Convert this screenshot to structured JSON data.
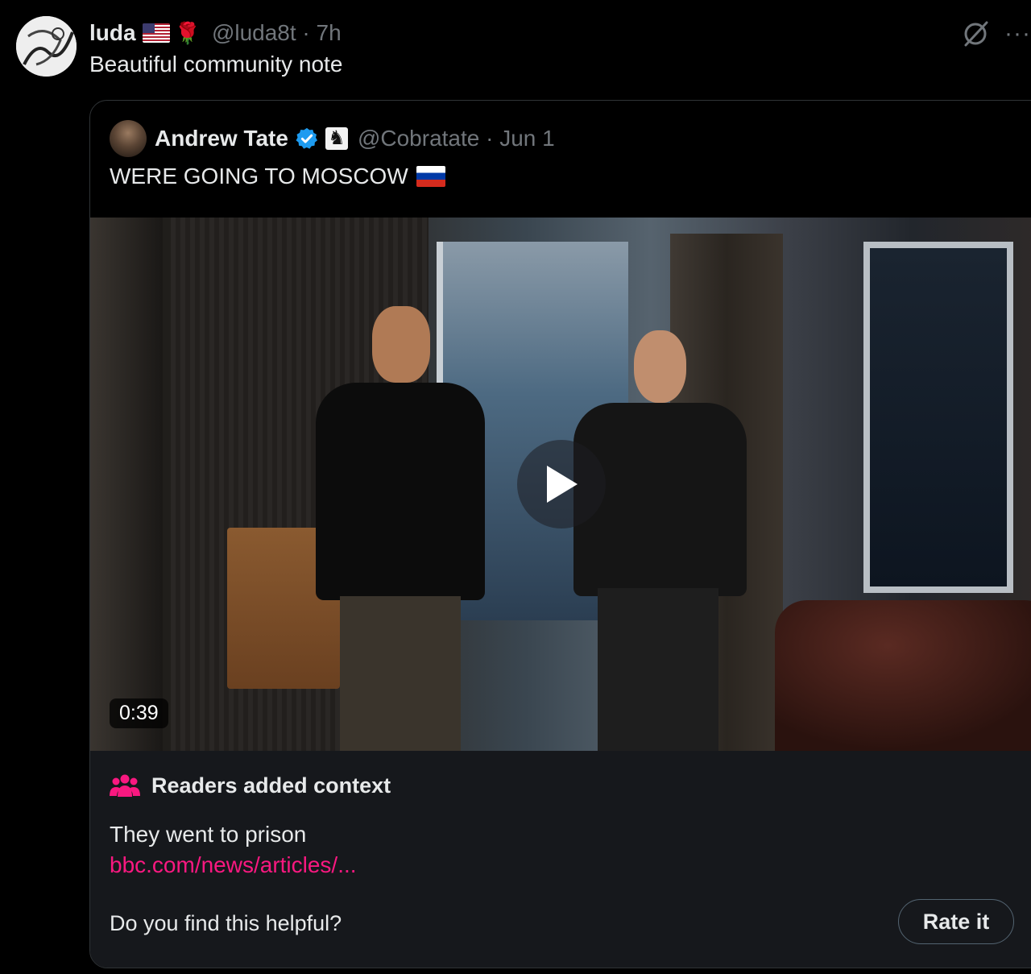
{
  "post": {
    "display_name": "luda",
    "flag_icon": "us-flag-icon",
    "rose_icon": "rose-icon",
    "handle_time": "@luda8t · 7h",
    "text": "Beautiful community note",
    "more_label": "···"
  },
  "quote": {
    "display_name": "Andrew Tate",
    "verified_icon": "verified-badge-icon",
    "affiliate_icon": "chess-knight-icon",
    "handle_time": "@Cobratate · Jun 1",
    "text": "WERE GOING TO MOSCOW",
    "flag_icon": "russia-flag-icon",
    "video": {
      "duration": "0:39",
      "play_icon": "play-icon"
    }
  },
  "note": {
    "title": "Readers added context",
    "body": "They went to prison",
    "link": "bbc.com/news/articles/...",
    "question": "Do you find this helpful?",
    "rate_label": "Rate it"
  },
  "colors": {
    "background": "#000000",
    "text_primary": "#e7e9ea",
    "text_secondary": "#71767b",
    "verified_blue": "#1d9bf0",
    "note_pink": "#f91880",
    "note_bg": "#16181c"
  }
}
